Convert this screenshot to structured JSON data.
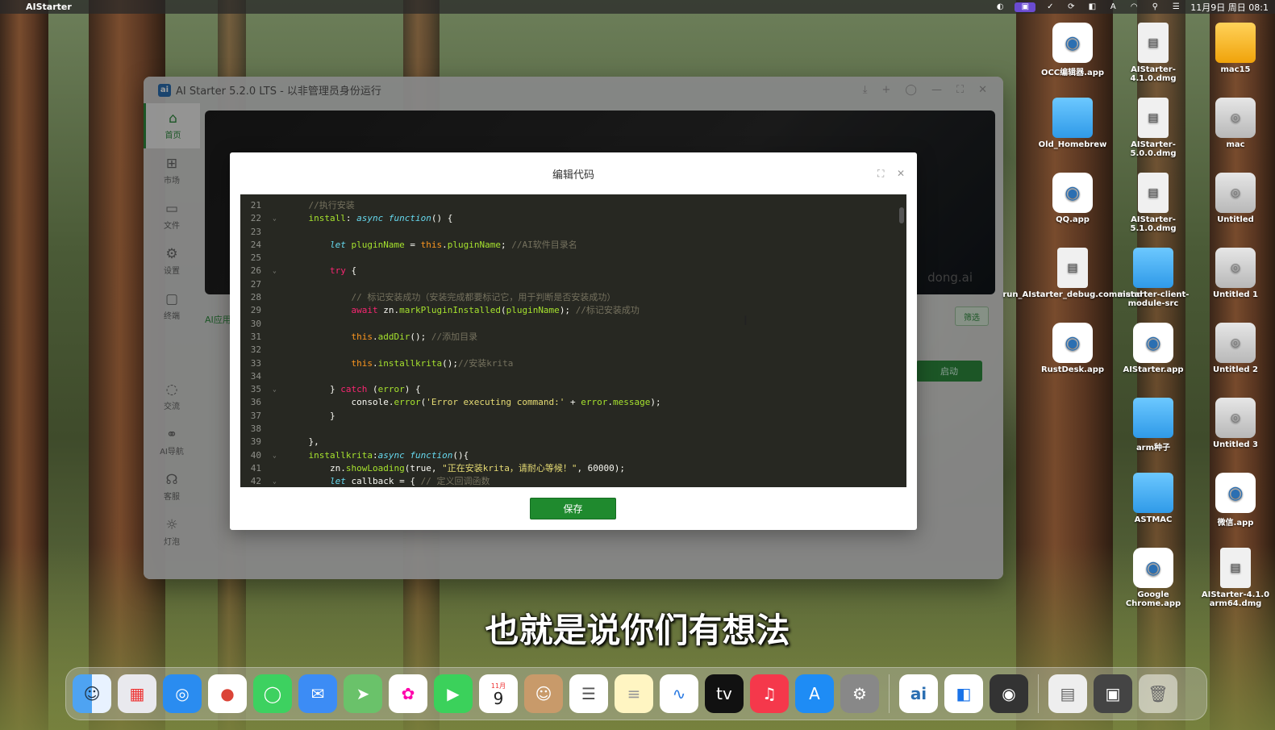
{
  "menubar": {
    "app_name": "AIStarter",
    "datetime": "11月9日 周日 08:1"
  },
  "window": {
    "title": "AI Starter 5.2.0 LTS - 以非管理员身份运行",
    "banner_url": "dong.ai",
    "tab_hint": "AI应用",
    "filter_label": "筛选",
    "launch_label": "启动"
  },
  "sidebar": {
    "items": [
      {
        "label": "首页",
        "icon": "home-icon"
      },
      {
        "label": "市场",
        "icon": "store-icon"
      },
      {
        "label": "文件",
        "icon": "folder-icon"
      },
      {
        "label": "设置",
        "icon": "gear-icon"
      },
      {
        "label": "终端",
        "icon": "terminal-icon"
      },
      {
        "label": "交流",
        "icon": "chat-icon"
      },
      {
        "label": "AI导航",
        "icon": "link-icon"
      },
      {
        "label": "客服",
        "icon": "headset-icon"
      },
      {
        "label": "灯泡",
        "icon": "bulb-icon"
      }
    ]
  },
  "modal": {
    "title": "编辑代码",
    "save_label": "保存",
    "code_lines": [
      {
        "n": "21",
        "fold": "",
        "code": "    //执行安装"
      },
      {
        "n": "22",
        "fold": "⌄",
        "code": "    install: async function() {"
      },
      {
        "n": "23",
        "fold": "",
        "code": ""
      },
      {
        "n": "24",
        "fold": "",
        "code": "        let pluginName = this.pluginName; //AI软件目录名"
      },
      {
        "n": "25",
        "fold": "",
        "code": ""
      },
      {
        "n": "26",
        "fold": "⌄",
        "code": "        try {"
      },
      {
        "n": "27",
        "fold": "",
        "code": ""
      },
      {
        "n": "28",
        "fold": "",
        "code": "            // 标记安装成功（安装完成都要标记它，用于判断是否安装成功）"
      },
      {
        "n": "29",
        "fold": "",
        "code": "            await zn.markPluginInstalled(pluginName); //标记安装成功"
      },
      {
        "n": "30",
        "fold": "",
        "code": ""
      },
      {
        "n": "31",
        "fold": "",
        "code": "            this.addDir(); //添加目录"
      },
      {
        "n": "32",
        "fold": "",
        "code": ""
      },
      {
        "n": "33",
        "fold": "",
        "code": "            this.installkrita();//安装krita"
      },
      {
        "n": "34",
        "fold": "",
        "code": ""
      },
      {
        "n": "35",
        "fold": "⌄",
        "code": "        } catch (error) {"
      },
      {
        "n": "36",
        "fold": "",
        "code": "            console.error('Error executing command:' + error.message);"
      },
      {
        "n": "37",
        "fold": "",
        "code": "        }"
      },
      {
        "n": "38",
        "fold": "",
        "code": ""
      },
      {
        "n": "39",
        "fold": "",
        "code": "    },"
      },
      {
        "n": "40",
        "fold": "⌄",
        "code": "    installkrita:async function(){"
      },
      {
        "n": "41",
        "fold": "",
        "code": "        zn.showLoading(true, \"正在安装krita，请耐心等候！\", 60000);"
      },
      {
        "n": "42",
        "fold": "⌄",
        "code": "        let callback = { // 定义回调函数"
      }
    ]
  },
  "desktop_icons": [
    {
      "label": "OCC编辑器.app",
      "kind": "app"
    },
    {
      "label": "AIStarter-4.1.0.dmg",
      "kind": "doc"
    },
    {
      "label": "mac15",
      "kind": "folder-orange"
    },
    {
      "label": "Old_Homebrew",
      "kind": "folder"
    },
    {
      "label": "AIStarter-5.0.0.dmg",
      "kind": "doc"
    },
    {
      "label": "mac",
      "kind": "disk"
    },
    {
      "label": "QQ.app",
      "kind": "app"
    },
    {
      "label": "AIStarter-5.1.0.dmg",
      "kind": "doc"
    },
    {
      "label": "Untitled",
      "kind": "disk"
    },
    {
      "label": "run_AIstarter_debug.command",
      "kind": "doc"
    },
    {
      "label": "aistarter-client-module-src",
      "kind": "folder"
    },
    {
      "label": "Untitled 1",
      "kind": "disk"
    },
    {
      "label": "RustDesk.app",
      "kind": "app"
    },
    {
      "label": "AIStarter.app",
      "kind": "app"
    },
    {
      "label": "Untitled 2",
      "kind": "disk"
    },
    {
      "label": "arm种子",
      "kind": "folder"
    },
    {
      "label": "Untitled 3",
      "kind": "disk"
    },
    {
      "label": "ASTMAC",
      "kind": "folder"
    },
    {
      "label": "微信.app",
      "kind": "app"
    },
    {
      "label": "Google Chrome.app",
      "kind": "app"
    },
    {
      "label": "AIStarter-4.1.0 arm64.dmg",
      "kind": "doc"
    }
  ],
  "subtitle": "也就是说你们有想法",
  "dock": {
    "calendar_month": "11月",
    "calendar_day": "9",
    "apps": [
      "finder-icon",
      "launchpad-icon",
      "safari-icon",
      "chrome-icon",
      "messages-icon",
      "mail-icon",
      "maps-icon",
      "photos-icon",
      "facetime-icon",
      "calendar-icon",
      "contacts-icon",
      "reminders-icon",
      "notes-icon",
      "freeform-icon",
      "tv-icon",
      "music-icon",
      "appstore-icon",
      "settings-icon"
    ]
  }
}
